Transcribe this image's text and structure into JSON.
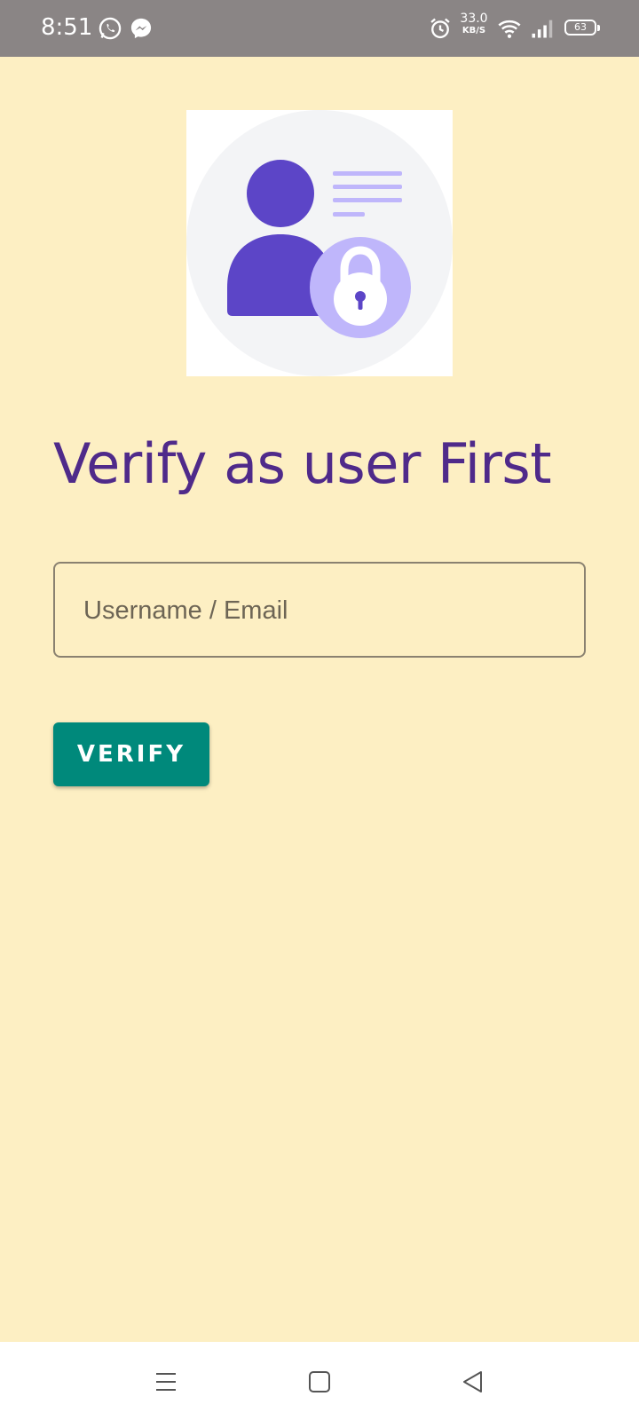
{
  "status_bar": {
    "time": "8:51",
    "left_icons": [
      "whatsapp-icon",
      "messenger-icon"
    ],
    "net_speed_value": "33.0",
    "net_speed_unit": "KB/S",
    "battery_level": "63",
    "right_icons": [
      "alarm-icon",
      "wifi-icon",
      "signal-icon",
      "battery-icon"
    ]
  },
  "hero": {
    "icon": "user-lock-illustration",
    "colors": {
      "person": "#5c45c7",
      "lock_circle": "#bfb6fb",
      "background_circle": "#f3f4f6"
    }
  },
  "page": {
    "title": "Verify as user First"
  },
  "form": {
    "username_placeholder": "Username / Email",
    "username_value": "",
    "verify_label": "VERIFY"
  },
  "nav_bar": {
    "icons": [
      "menu-icon",
      "home-icon",
      "back-icon"
    ]
  },
  "colors": {
    "background": "#fdefc3",
    "title": "#4f2a8a",
    "button": "#00897b",
    "status_bar": "#8a8585"
  }
}
